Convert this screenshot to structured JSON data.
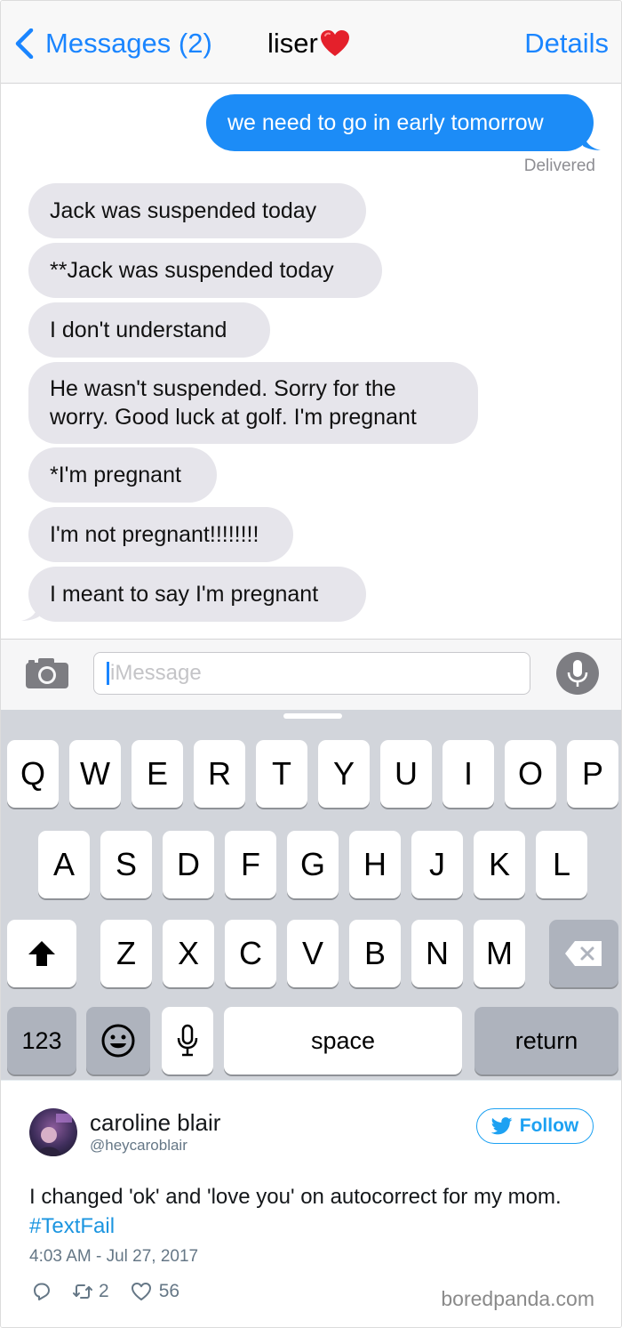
{
  "nav": {
    "back_label": "Messages (2)",
    "contact": "liser",
    "details_label": "Details"
  },
  "chat": {
    "outgoing": [
      {
        "text": "we need to go in early tomorrow"
      }
    ],
    "delivered": "Delivered",
    "incoming": [
      {
        "text": "Jack was suspended today"
      },
      {
        "text": "**Jack was suspended today"
      },
      {
        "text": "I don't understand"
      },
      {
        "text": "He wasn't suspended. Sorry for the worry. Good luck at golf. I'm pregnant",
        "line1": "He wasn't suspended. Sorry for the",
        "line2": "worry. Good luck at golf. I'm pregnant"
      },
      {
        "text": "*I'm pregnant"
      },
      {
        "text": "I'm not pregnant!!!!!!!!"
      },
      {
        "text": "I meant to say I'm pregnant"
      }
    ]
  },
  "input": {
    "placeholder": "iMessage"
  },
  "keyboard": {
    "row1": [
      "Q",
      "W",
      "E",
      "R",
      "T",
      "Y",
      "U",
      "I",
      "O",
      "P"
    ],
    "row2": [
      "A",
      "S",
      "D",
      "F",
      "G",
      "H",
      "J",
      "K",
      "L"
    ],
    "row3": [
      "Z",
      "X",
      "C",
      "V",
      "B",
      "N",
      "M"
    ],
    "numbers_key": "123",
    "space_key": "space",
    "return_key": "return"
  },
  "tweet": {
    "name": "caroline blair",
    "handle": "@heycaroblair",
    "follow_label": "Follow",
    "text_before": "I changed 'ok' and 'love you' on autocorrect for my mom. ",
    "hashtag": "#TextFail",
    "timestamp": "4:03 AM - Jul 27, 2017",
    "retweets": "2",
    "likes": "56"
  },
  "watermark": "boredpanda.com",
  "colors": {
    "imessage_blue": "#1c8cf7",
    "ios_link_blue": "#1a85ff",
    "twitter_blue": "#1da1f2",
    "incoming_bubble": "#e6e5eb",
    "keyboard_bg": "#d2d5db"
  },
  "icons": [
    "chevron-left-icon",
    "heart-icon",
    "camera-icon",
    "microphone-icon",
    "shift-icon",
    "backspace-icon",
    "emoji-icon",
    "dictation-icon",
    "twitter-bird-icon",
    "reply-icon",
    "retweet-icon",
    "like-icon"
  ]
}
